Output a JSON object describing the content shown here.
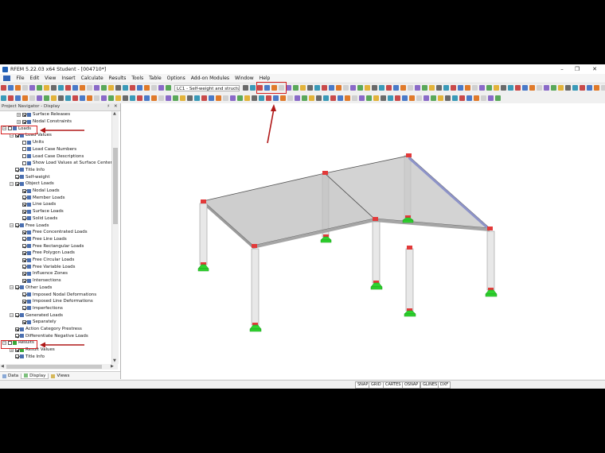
{
  "window": {
    "title": "RFEM 5.22.03 x64 Student - [004710*]",
    "minimize": "–",
    "maximize": "❐",
    "close": "✕"
  },
  "menu": [
    "File",
    "Edit",
    "View",
    "Insert",
    "Calculate",
    "Results",
    "Tools",
    "Table",
    "Options",
    "Add-on Modules",
    "Window",
    "Help"
  ],
  "toolbar": {
    "loadcase_combo": "LC1 - Self-weight and structure"
  },
  "navigator": {
    "title": "Project Navigator - Display",
    "pin": "♯",
    "close": "✕",
    "items": [
      {
        "label": "Surface Releases",
        "indent": 2,
        "checked": true,
        "expander": "+"
      },
      {
        "label": "Nodal Constraints",
        "indent": 2,
        "checked": true,
        "expander": "+"
      },
      {
        "label": "Loads",
        "indent": 0,
        "checked": false,
        "expander": "−"
      },
      {
        "label": "Load Values",
        "indent": 1,
        "checked": true,
        "expander": "−"
      },
      {
        "label": "Units",
        "indent": 2,
        "checked": false,
        "expander": ""
      },
      {
        "label": "Load Case Numbers",
        "indent": 2,
        "checked": false,
        "expander": ""
      },
      {
        "label": "Load Case Descriptions",
        "indent": 2,
        "checked": false,
        "expander": ""
      },
      {
        "label": "Show Load Values at Surface Center",
        "indent": 2,
        "checked": false,
        "expander": ""
      },
      {
        "label": "Title Info",
        "indent": 1,
        "checked": true,
        "expander": ""
      },
      {
        "label": "Self-weight",
        "indent": 1,
        "checked": true,
        "expander": ""
      },
      {
        "label": "Object Loads",
        "indent": 1,
        "checked": true,
        "expander": "−"
      },
      {
        "label": "Nodal Loads",
        "indent": 2,
        "checked": true,
        "expander": ""
      },
      {
        "label": "Member Loads",
        "indent": 2,
        "checked": true,
        "expander": ""
      },
      {
        "label": "Line Loads",
        "indent": 2,
        "checked": true,
        "expander": ""
      },
      {
        "label": "Surface Loads",
        "indent": 2,
        "checked": true,
        "expander": ""
      },
      {
        "label": "Solid Loads",
        "indent": 2,
        "checked": true,
        "expander": ""
      },
      {
        "label": "Free Loads",
        "indent": 1,
        "checked": true,
        "expander": "−"
      },
      {
        "label": "Free Concentrated Loads",
        "indent": 2,
        "checked": true,
        "expander": ""
      },
      {
        "label": "Free Line Loads",
        "indent": 2,
        "checked": true,
        "expander": ""
      },
      {
        "label": "Free Rectangular Loads",
        "indent": 2,
        "checked": true,
        "expander": ""
      },
      {
        "label": "Free Polygon Loads",
        "indent": 2,
        "checked": true,
        "expander": ""
      },
      {
        "label": "Free Circular Loads",
        "indent": 2,
        "checked": true,
        "expander": ""
      },
      {
        "label": "Free Variable Loads",
        "indent": 2,
        "checked": true,
        "expander": ""
      },
      {
        "label": "Influence Zones",
        "indent": 2,
        "checked": true,
        "expander": ""
      },
      {
        "label": "Intersections",
        "indent": 2,
        "checked": true,
        "expander": ""
      },
      {
        "label": "Other Loads",
        "indent": 1,
        "checked": true,
        "expander": "−"
      },
      {
        "label": "Imposed Nodal Deformations",
        "indent": 2,
        "checked": true,
        "expander": ""
      },
      {
        "label": "Imposed Line Deformations",
        "indent": 2,
        "checked": true,
        "expander": ""
      },
      {
        "label": "Imperfections",
        "indent": 2,
        "checked": true,
        "expander": ""
      },
      {
        "label": "Generated Loads",
        "indent": 1,
        "checked": true,
        "expander": "−"
      },
      {
        "label": "Separately",
        "indent": 2,
        "checked": true,
        "expander": ""
      },
      {
        "label": "Action Category Prestress",
        "indent": 1,
        "checked": true,
        "expander": ""
      },
      {
        "label": "Differentiate Negative Loads",
        "indent": 1,
        "checked": true,
        "expander": ""
      },
      {
        "label": "Results",
        "indent": 0,
        "checked": false,
        "expander": "−"
      },
      {
        "label": "Result Values",
        "indent": 1,
        "checked": true,
        "expander": "+"
      },
      {
        "label": "Title Info",
        "indent": 1,
        "checked": true,
        "expander": ""
      }
    ],
    "tabs": [
      "Data",
      "Display",
      "Views"
    ]
  },
  "statusbar": [
    "SNAP",
    "GRID",
    "CARTES",
    "OSNAP",
    "GLINES",
    "DXF"
  ],
  "colors": {
    "highlight": "#d62020",
    "support": "#2fd32f",
    "node": "#e23a3a",
    "slab": "#b8b8b8"
  }
}
